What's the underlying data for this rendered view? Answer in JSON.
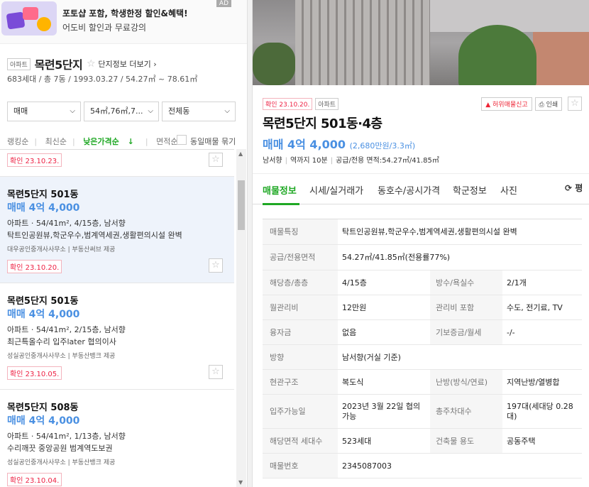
{
  "ad": {
    "badge": "AD",
    "title": "포토샵 포함, 학생한정 할인&혜택!",
    "subtitle": "어도비 할인과 무료강의"
  },
  "complex": {
    "type_tag": "아파트",
    "name": "목련5단지",
    "more_link": "단지정보 더보기",
    "info": "683세대 / 총 7동 / 1993.03.27 / 54.27㎡ ~ 78.61㎡"
  },
  "filters": {
    "trade": "매매",
    "area": "54㎡,76㎡,7...",
    "dong": "전체동"
  },
  "sort": {
    "options": [
      "랭킹순",
      "최신순",
      "낮은가격순",
      "면적순"
    ],
    "active": "낮은가격순",
    "same_listing_label": "동일매물 묶기"
  },
  "listings": [
    {
      "confirm": "확인 23.10.23."
    },
    {
      "title": "목련5단지 501동",
      "price": "매매 4억 4,000",
      "spec": "아파트 · 54/41m², 4/15층, 남서향",
      "desc": "탁트인공원뷰,학군우수,범계역세권,생활편의시설 완벽",
      "agent": "대우공인중개사사무소 | 부동산써브 제공",
      "confirm": "확인 23.10.20."
    },
    {
      "title": "목련5단지 501동",
      "price": "매매 4억 4,000",
      "spec": "아파트 · 54/41m², 2/15층, 남서향",
      "desc": "최근특올수리 입주later 협의이사",
      "agent": "성실공인중개사사무소 | 부동산뱅크 제공",
      "confirm": "확인 23.10.05."
    },
    {
      "title": "목련5단지 508동",
      "price": "매매 4억 4,000",
      "spec": "아파트 · 54/41m², 1/13층, 남서향",
      "desc": "수리깨끗 중앙공원 범계역도보권",
      "agent": "성실공인중개사사무소 | 부동산뱅크 제공",
      "confirm": "확인 23.10.04."
    }
  ],
  "detail": {
    "confirm": "확인 23.10.20.",
    "type_tag": "아파트",
    "report_btn": "허위매물신고",
    "print_btn": "인쇄",
    "title": "목련5단지 501동·4층",
    "price": "매매 4억 4,000",
    "price_per": "(2,680만원/3.3㎡)",
    "meta": [
      "남서향",
      "역까지 10분",
      "공급/전용 면적:54.27㎡/41.85㎡"
    ],
    "tabs": [
      "매물정보",
      "시세/실거래가",
      "동호수/공시가격",
      "학군정보",
      "사진"
    ],
    "active_tab": "매물정보",
    "refresh": "평",
    "rows": [
      {
        "l1": "매물특징",
        "v1": "탁트인공원뷰,학군우수,범계역세권,생활편의시설 완벽"
      },
      {
        "l1": "공급/전용면적",
        "v1": "54.27㎡/41.85㎡(전용률77%)"
      },
      {
        "l1": "해당층/총층",
        "v1": "4/15층",
        "l2": "방수/욕실수",
        "v2": "2/1개"
      },
      {
        "l1": "월관리비",
        "v1": "12만원",
        "l2": "관리비 포함",
        "v2": "수도, 전기료, TV"
      },
      {
        "l1": "융자금",
        "v1": "없음",
        "l2": "기보증금/월세",
        "v2": "-/-"
      },
      {
        "l1": "방향",
        "v1": "남서향(거실 기준)"
      },
      {
        "l1": "현관구조",
        "v1": "복도식",
        "l2": "난방(방식/연료)",
        "v2": "지역난방/열병합"
      },
      {
        "l1": "입주가능일",
        "v1": "2023년 3월 22일 협의가능",
        "l2": "총주차대수",
        "v2": "197대(세대당 0.28대)"
      },
      {
        "l1": "해당면적 세대수",
        "v1": "523세대",
        "l2": "건축물 용도",
        "v2": "공동주택"
      },
      {
        "l1": "매물번호",
        "v1": "2345087003"
      }
    ]
  }
}
